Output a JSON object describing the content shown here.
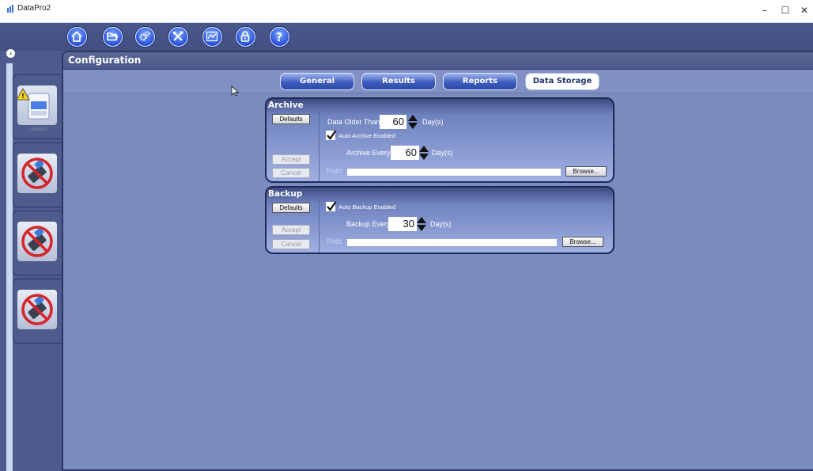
{
  "window": {
    "title": "DataPro2",
    "minimize": "–",
    "maximize": "☐",
    "close": "✕"
  },
  "toolbar": {
    "icons": [
      "home-icon",
      "folder-icon",
      "gears-icon",
      "tools-icon",
      "chart-icon",
      "lock-icon",
      "help-icon"
    ],
    "help_glyph": "?"
  },
  "sidebar": {
    "collapse_glyph": "‹",
    "slots": [
      {
        "type": "device",
        "label": "CAN-0001",
        "warning": true
      },
      {
        "type": "no-device"
      },
      {
        "type": "no-device"
      },
      {
        "type": "no-device"
      }
    ]
  },
  "config": {
    "title": "Configuration",
    "tabs": [
      "General",
      "Results",
      "Reports",
      "Data Storage"
    ],
    "active_tab": "Data Storage"
  },
  "archive": {
    "title": "Archive",
    "defaults": "Defaults",
    "accept": "Accept",
    "cancel": "Cancel",
    "older_label": "Data Older Than:",
    "older_value": "60",
    "older_unit": "Day(s)",
    "auto_label": "Auto Archive Enabled",
    "auto_checked": true,
    "every_label": "Archive Every:",
    "every_value": "60",
    "every_unit": "Day(s)",
    "path_label": "Path:",
    "path_value": "",
    "browse": "Browse..."
  },
  "backup": {
    "title": "Backup",
    "defaults": "Defaults",
    "accept": "Accept",
    "cancel": "Cancel",
    "auto_label": "Auto Backup Enabled",
    "auto_checked": true,
    "every_label": "Backup Every:",
    "every_value": "30",
    "every_unit": "Day(s)",
    "path_label": "Path:",
    "path_value": "",
    "browse": "Browse..."
  },
  "colors": {
    "app_bg": "#4d5a8b",
    "panel_bg": "#7a8cbd",
    "tab_active": "#ffffff",
    "accent_blue": "#2a52d8"
  }
}
